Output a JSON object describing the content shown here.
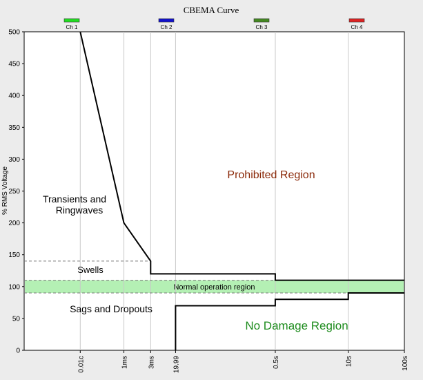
{
  "chart_data": {
    "type": "line",
    "title": "CBEMA Curve",
    "ylabel": "% RMS Voltage",
    "xlabel": "",
    "ylim": [
      0,
      500
    ],
    "y_ticks": [
      0,
      50,
      100,
      150,
      200,
      250,
      300,
      350,
      400,
      450,
      500
    ],
    "x_scale": "log",
    "x_ticks": [
      {
        "label": "0.01c",
        "value": 0.01
      },
      {
        "label": "1ms",
        "value": 0.06
      },
      {
        "label": "3ms",
        "value": 0.18
      },
      {
        "label": "19.99",
        "value": 0.5
      },
      {
        "label": "0.5s",
        "value": 30
      },
      {
        "label": "10s",
        "value": 600
      },
      {
        "label": "100s",
        "value": 6000
      }
    ],
    "xlim": [
      0.001,
      6000
    ],
    "grid": true,
    "legend": {
      "placement": "top",
      "items": [
        {
          "label": "Ch 1",
          "color": "#22dd22"
        },
        {
          "label": "Ch 2",
          "color": "#1111cc"
        },
        {
          "label": "Ch 3",
          "color": "#448822"
        },
        {
          "label": "Ch 4",
          "color": "#dd2222"
        }
      ]
    },
    "series": [
      {
        "color": "#000000",
        "points": [
          [
            0.01,
            500
          ],
          [
            0.06,
            200
          ],
          [
            0.18,
            140
          ],
          [
            0.18,
            120
          ],
          [
            30,
            120
          ],
          [
            30,
            110
          ],
          [
            6000,
            110
          ]
        ]
      },
      {
        "color": "#000000",
        "points": [
          [
            0.5,
            0
          ],
          [
            0.5,
            70
          ],
          [
            30,
            70
          ],
          [
            30,
            80
          ],
          [
            600,
            80
          ],
          [
            600,
            90
          ],
          [
            6000,
            90
          ]
        ]
      }
    ],
    "bands": [
      {
        "label": "Normal operation region",
        "y_range": [
          90,
          110
        ],
        "color": "#b4f0b4"
      }
    ],
    "reference_lines": [
      {
        "y": 140,
        "x_range": [
          0.001,
          0.18
        ]
      },
      {
        "y": 110,
        "x_range": [
          0.001,
          30
        ]
      },
      {
        "y": 90,
        "x_range": [
          0.001,
          6000
        ]
      }
    ],
    "annotations": [
      {
        "text": "Prohibited Region",
        "color": "#8b2a0a"
      },
      {
        "text": "Transients and",
        "color": "#000000"
      },
      {
        "text": "Ringwaves",
        "color": "#000000"
      },
      {
        "text": "Swells",
        "color": "#000000"
      },
      {
        "text": "Sags and Dropouts",
        "color": "#000000"
      },
      {
        "text": "No Damage Region",
        "color": "#1e8c1e"
      }
    ]
  }
}
